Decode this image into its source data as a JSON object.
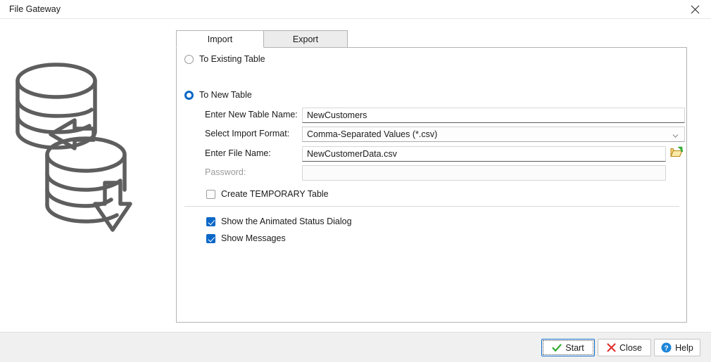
{
  "window": {
    "title": "File Gateway",
    "close_icon": "close-icon"
  },
  "illustration": {
    "database_in_icon": "database-import-icon",
    "database_out_icon": "database-export-icon"
  },
  "tabs": [
    {
      "id": "import",
      "label": "Import",
      "selected": true
    },
    {
      "id": "export",
      "label": "Export",
      "selected": false
    }
  ],
  "import_panel": {
    "destination_radios": [
      {
        "id": "existing",
        "label": "To Existing Table",
        "checked": false
      },
      {
        "id": "new",
        "label": "To New Table",
        "checked": true
      }
    ],
    "fields": {
      "table_name": {
        "label": "Enter New Table Name:",
        "value": "NewCustomers",
        "placeholder": ""
      },
      "import_format": {
        "label": "Select Import Format:",
        "value": "Comma-Separated Values  (*.csv)",
        "chevron_icon": "chevron-down-icon",
        "options": [
          "Comma-Separated Values  (*.csv)"
        ]
      },
      "file_name": {
        "label": "Enter File Name:",
        "value": "NewCustomerData.csv",
        "placeholder": "",
        "browse_icon": "open-folder-icon"
      },
      "password": {
        "label": "Password:",
        "value": "",
        "placeholder": "",
        "disabled": true
      }
    },
    "checkboxes": [
      {
        "id": "temporary",
        "label": "Create TEMPORARY Table",
        "checked": false
      },
      {
        "id": "animated-status",
        "label": "Show the Animated Status Dialog",
        "checked": true
      },
      {
        "id": "show-messages",
        "label": "Show Messages",
        "checked": true
      }
    ]
  },
  "footer": {
    "buttons": [
      {
        "id": "start",
        "label": "Start",
        "icon": "check-icon"
      },
      {
        "id": "close",
        "label": "Close",
        "icon": "x-icon"
      },
      {
        "id": "help",
        "label": "Help",
        "icon": "question-icon"
      }
    ]
  },
  "colors": {
    "accent": "#0a67c8",
    "check_green": "#2faa2f",
    "close_red": "#e03030",
    "help_blue": "#1e86d8",
    "folder_yellow": "#f0c14b",
    "outline_gray": "#5c5c5c",
    "footer_bg": "#f0f0f0"
  }
}
